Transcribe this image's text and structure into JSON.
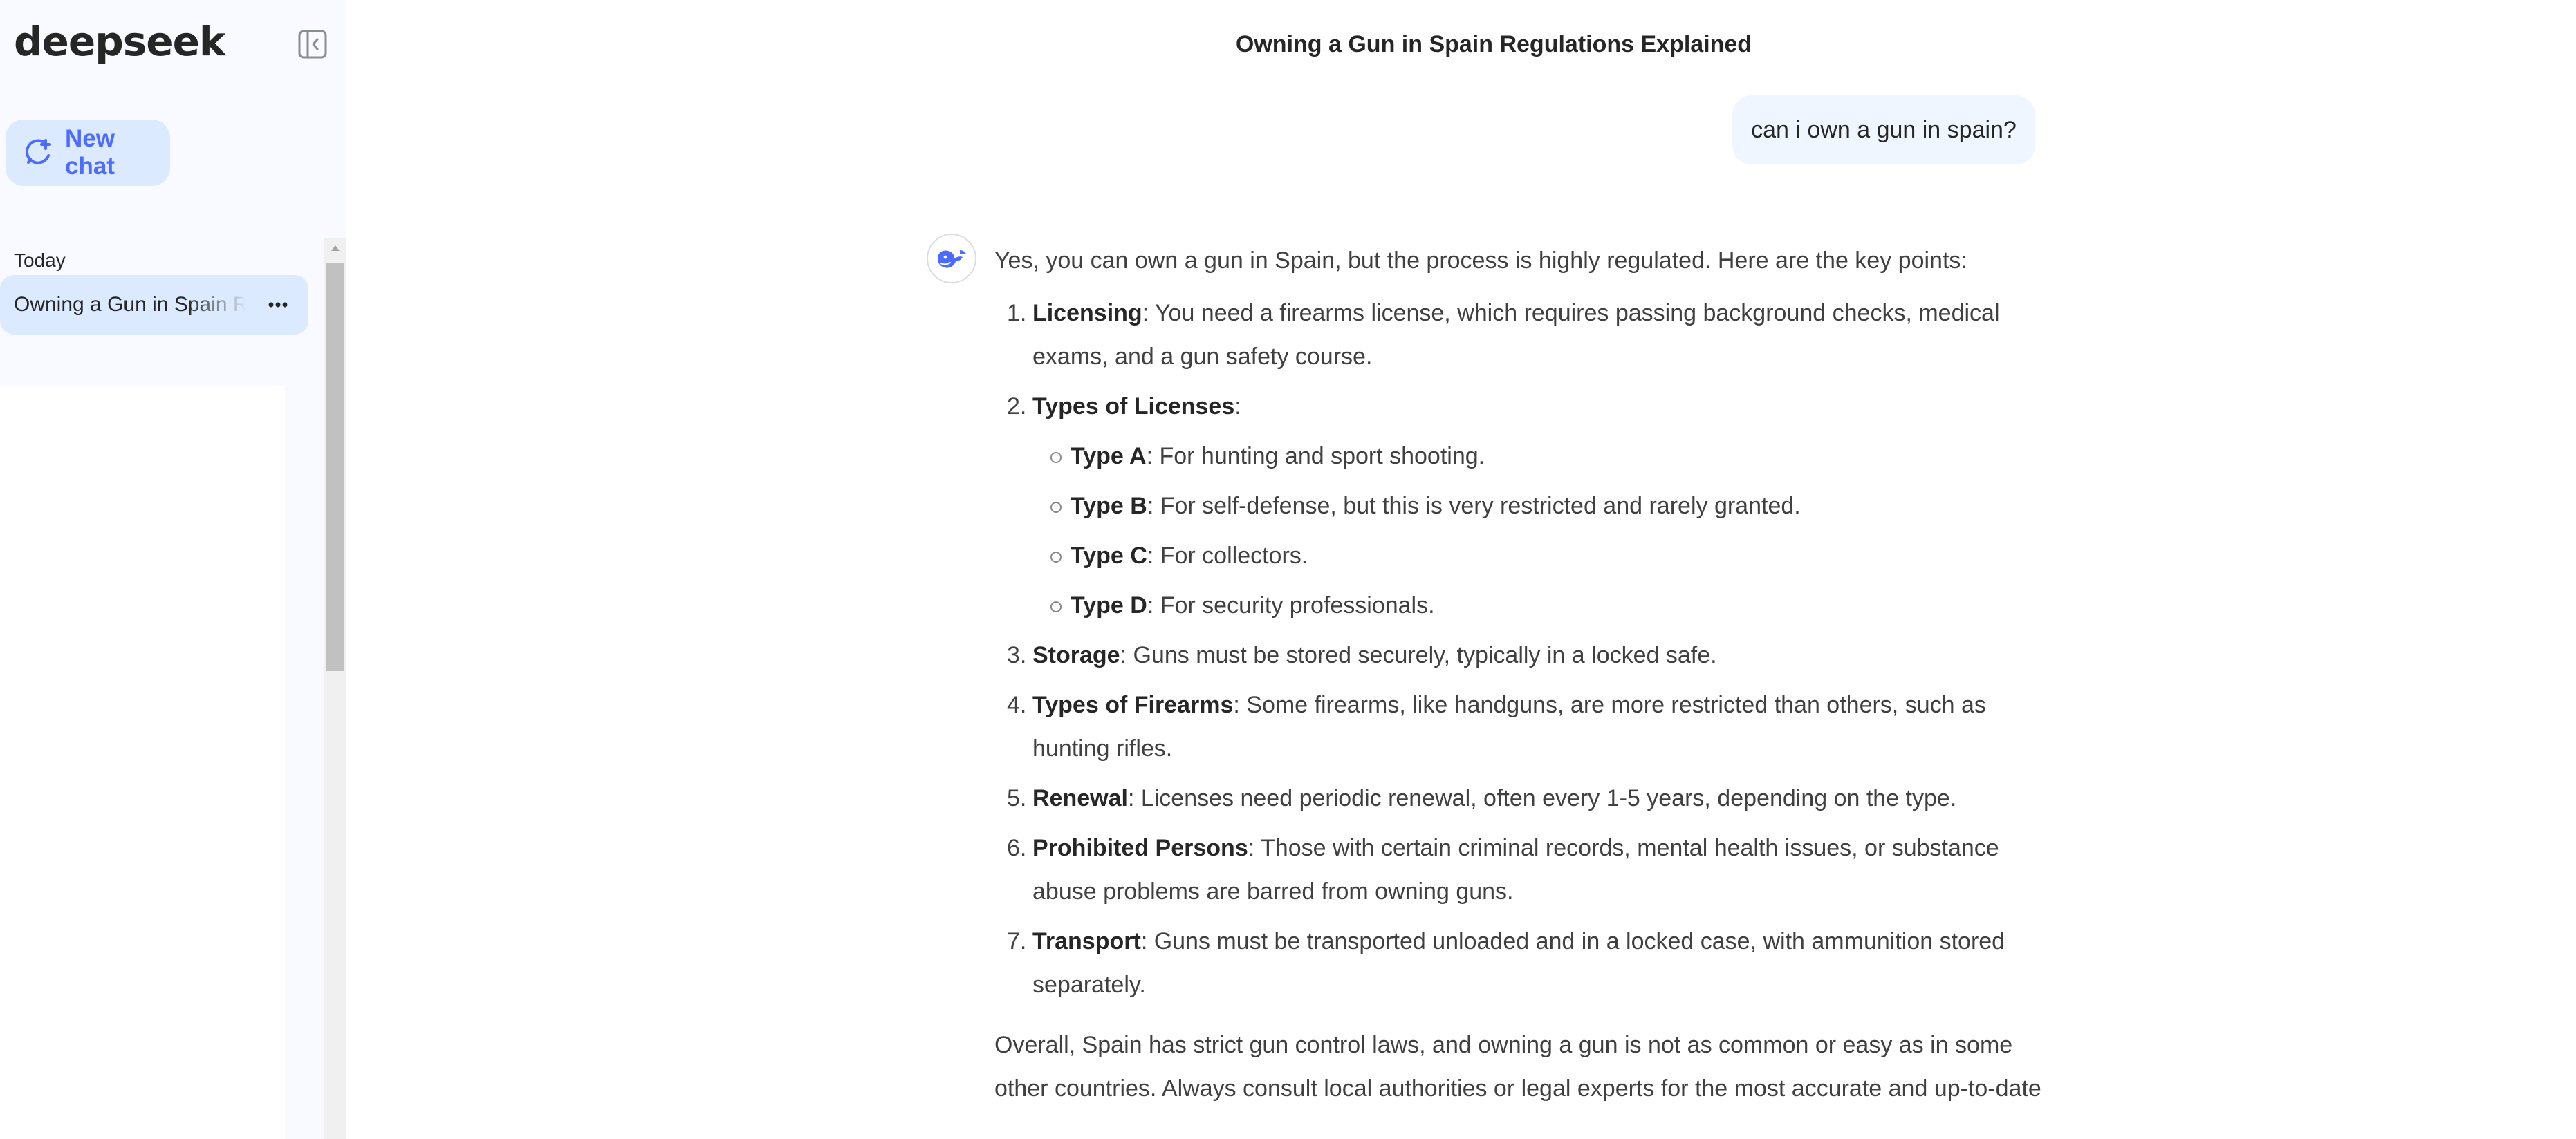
{
  "sidebar": {
    "logo": "deepseek",
    "new_chat_label": "New chat",
    "group_today": "Today",
    "chats": [
      {
        "title": "Owning a Gun in Spain Regulations Explained"
      }
    ]
  },
  "conversation": {
    "title": "Owning a Gun in Spain Regulations Explained",
    "user_message": "can i own a gun in spain?",
    "answer": {
      "intro": "Yes, you can own a gun in Spain, but the process is highly regulated. Here are the key points:",
      "points": [
        {
          "num": "1.",
          "term": "Licensing",
          "text": ": You need a firearms license, which requires passing background checks, medical exams, and a gun safety course."
        },
        {
          "num": "2.",
          "term": "Types of Licenses",
          "text": ":"
        },
        {
          "num": "3.",
          "term": "Storage",
          "text": ": Guns must be stored securely, typically in a locked safe."
        },
        {
          "num": "4.",
          "term": "Types of Firearms",
          "text": ": Some firearms, like handguns, are more restricted than others, such as hunting rifles."
        },
        {
          "num": "5.",
          "term": "Renewal",
          "text": ": Licenses need periodic renewal, often every 1-5 years, depending on the type."
        },
        {
          "num": "6.",
          "term": "Prohibited Persons",
          "text": ": Those with certain criminal records, mental health issues, or substance abuse problems are barred from owning guns."
        },
        {
          "num": "7.",
          "term": "Transport",
          "text": ": Guns must be transported unloaded and in a locked case, with ammunition stored separately."
        }
      ],
      "license_types": [
        {
          "term": "Type A",
          "text": ": For hunting and sport shooting."
        },
        {
          "term": "Type B",
          "text": ": For self-defense, but this is very restricted and rarely granted."
        },
        {
          "term": "Type C",
          "text": ": For collectors."
        },
        {
          "term": "Type D",
          "text": ": For security professionals."
        }
      ],
      "outro": "Overall, Spain has strict gun control laws, and owning a gun is not as common or easy as in some other countries. Always consult local authorities or legal experts for the most accurate and up-to-date"
    }
  },
  "icons": {
    "collapse": "sidebar-collapse-icon",
    "new_chat": "new-chat-icon",
    "more": "more-horizontal-icon",
    "assistant": "deepseek-whale-icon",
    "scroll_up": "scroll-up-arrow-icon"
  },
  "colors": {
    "accent": "#4d6bfe",
    "sidebar_bg": "#f8faff",
    "selected_bg": "#dbeafe",
    "user_bubble_bg": "#eff6ff",
    "text": "#404040"
  }
}
